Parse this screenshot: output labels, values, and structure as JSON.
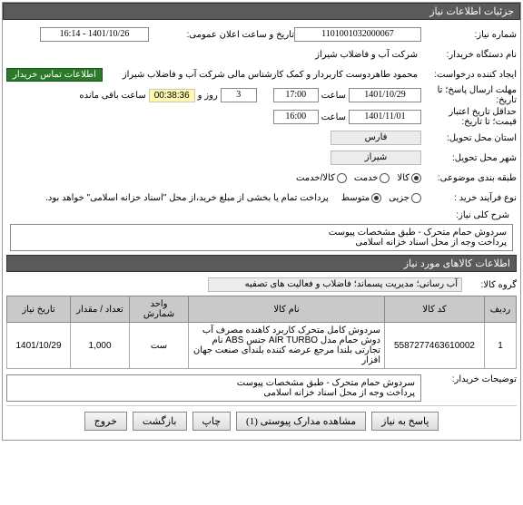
{
  "panel_title": "جزئیات اطلاعات نیاز",
  "fields": {
    "need_no_lbl": "شماره نیاز:",
    "need_no": "1101001032000067",
    "announce_lbl": "تاریخ و ساعت اعلان عمومی:",
    "announce": "1401/10/26 - 16:14",
    "buyer_lbl": "نام دستگاه خریدار:",
    "buyer": "شرکت آب و فاضلاب شیراز",
    "creator_lbl": "ایجاد کننده درخواست:",
    "creator": "محمود طاهردوست کاربردار و کمک کارشناس مالی شرکت آب و فاضلاب شیراز",
    "contact_badge": "اطلاعات تماس خریدار",
    "reply_lbl": "مهلت ارسال پاسخ؛ تا تاریخ:",
    "reply_date": "1401/10/29",
    "reply_time": "17:00",
    "remain_lbl": "روز و",
    "remain_days": "3",
    "remain_time": "00:38:36",
    "remain_suffix": "ساعت باقی مانده",
    "valid_lbl": "حداقل تاریخ اعتبار قیمت؛ تا تاریخ:",
    "valid_date": "1401/11/01",
    "valid_time": "16:00",
    "time_word": "ساعت",
    "province_lbl": "استان محل تحویل:",
    "province": "فارس",
    "city_lbl": "شهر محل تحویل:",
    "city": "شیراز",
    "class_lbl": "طبقه بندی موضوعی:",
    "class_opts": [
      "کالا",
      "خدمت",
      "کالا/خدمت"
    ],
    "class_sel": 0,
    "proc_lbl": "نوع فرآیند خرید :",
    "proc_opts": [
      "جزیی",
      "متوسط"
    ],
    "proc_sel": 1,
    "proc_note": "پرداخت تمام یا بخشی از مبلغ خرید،از محل \"اسناد خزانه اسلامی\" خواهد بود.",
    "desc_lbl": "شرح کلی نیاز:",
    "desc_l1": "سردوش حمام متحرک - طبق مشخصات پیوست",
    "desc_l2": "پرداخت وجه از محل اسناد خزانه اسلامی",
    "items_header": "اطلاعات کالاهای مورد نیاز",
    "group_lbl": "گروه کالا:",
    "group": "آب رسانی؛ مدیریت پسماند؛ فاضلاب و فعالیت های تصفیه",
    "cols": {
      "idx": "ردیف",
      "code": "کد کالا",
      "name": "نام کالا",
      "unit": "واحد شمارش",
      "qty": "تعداد / مقدار",
      "date": "تاریخ نیاز"
    },
    "rows": [
      {
        "idx": "1",
        "code": "5587277463610002",
        "name": "سردوش کامل متحرک کاربرد کاهنده مصرف آب دوش حمام مدل AIR TURBO جنس ABS نام تجارتی بلندا مرجع عرضه کننده بلندای صنعت جهان افزار",
        "unit": "ست",
        "qty": "1,000",
        "date": "1401/10/29"
      }
    ],
    "buyer_notes_lbl": "توضیحات خریدار:",
    "buyer_notes_l1": "سردوش حمام متحرک - طبق مشخصات پیوست",
    "buyer_notes_l2": "پرداخت وجه از محل اسناد خزانه اسلامی",
    "btns": {
      "reply": "پاسخ به نیاز",
      "attach": "مشاهده مدارک پیوستی (1)",
      "print": "چاپ",
      "back": "بازگشت",
      "exit": "خروج"
    }
  }
}
